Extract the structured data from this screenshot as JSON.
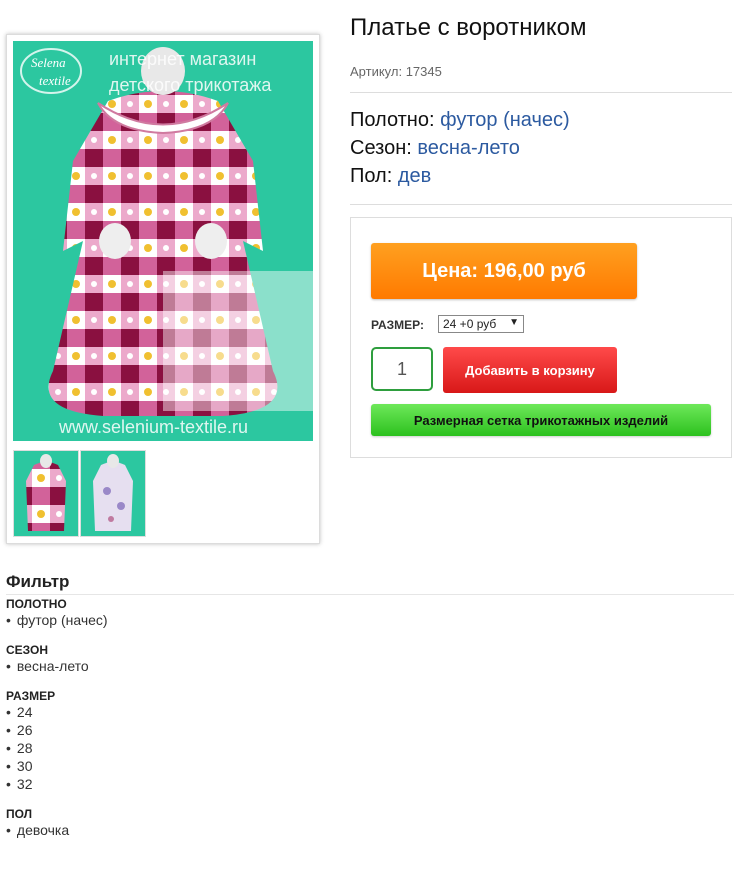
{
  "product": {
    "title": "Платье с воротником",
    "sku_label": "Артикул:",
    "sku": "17345"
  },
  "gallery": {
    "watermark_line1": "интернет магазин",
    "watermark_line2": "детского трикотажа",
    "watermark_url": "www.selenium-textile.ru",
    "logo_text1": "Selena",
    "logo_text2": "textile"
  },
  "attributes": [
    {
      "label": "Полотно:",
      "value": "футор (начес)"
    },
    {
      "label": "Сезон:",
      "value": "весна-лето"
    },
    {
      "label": "Пол:",
      "value": "дев"
    }
  ],
  "buy": {
    "price_label": "Цена: 196,00 руб",
    "size_label": "РАЗМЕР:",
    "size_selected": "24 +0 руб",
    "quantity": "1",
    "add_to_cart": "Добавить в корзину",
    "size_chart": "Размерная сетка трикотажных изделий"
  },
  "filter": {
    "title": "Фильтр",
    "groups": [
      {
        "title": "ПОЛОТНО",
        "items": [
          "футор (начес)"
        ]
      },
      {
        "title": "СЕЗОН",
        "items": [
          "весна-лето"
        ]
      },
      {
        "title": "РАЗМЕР",
        "items": [
          "24",
          "26",
          "28",
          "30",
          "32"
        ]
      },
      {
        "title": "ПОЛ",
        "items": [
          "девочка"
        ]
      }
    ]
  },
  "colors": {
    "background_teal": "#2cc7a0",
    "price_orange": "#ff8c10",
    "cart_red": "#e82828",
    "size_chart_green": "#3fd52e",
    "link_blue": "#2c5aa0"
  }
}
